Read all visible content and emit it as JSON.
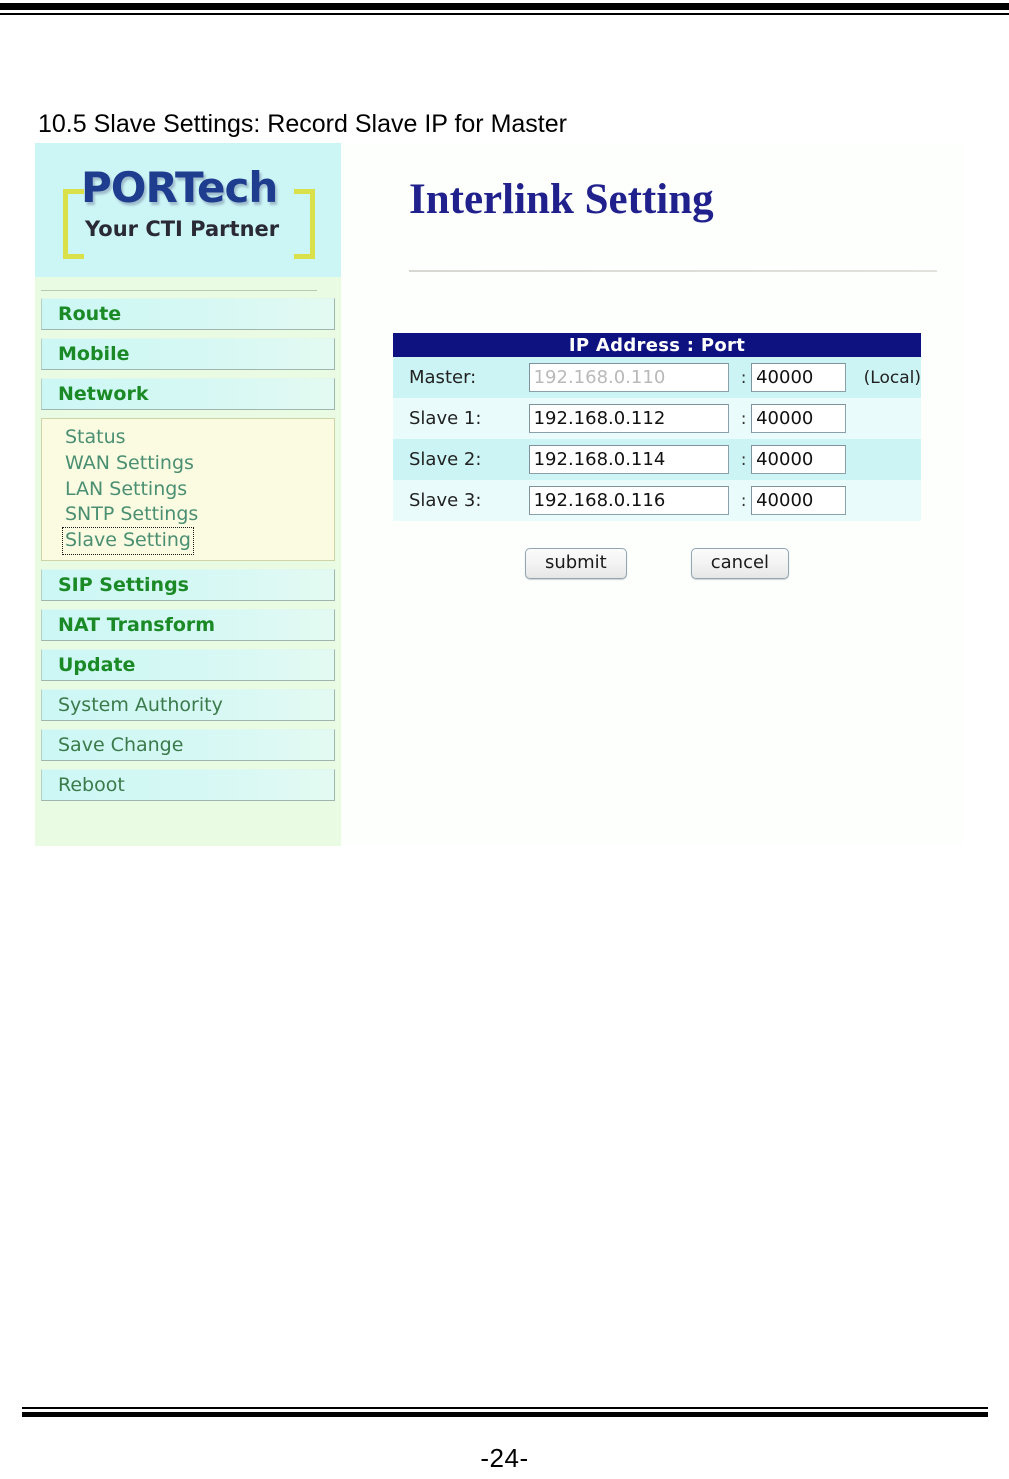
{
  "document": {
    "section_heading": "10.5 Slave Settings: Record Slave IP for Master",
    "page_number": "-24-"
  },
  "sidebar": {
    "logo": {
      "main": "PORTech",
      "tagline": "Your CTI Partner"
    },
    "menu": [
      {
        "label": "Route",
        "style": "bold"
      },
      {
        "label": "Mobile",
        "style": "bold"
      },
      {
        "label": "Network",
        "style": "bold"
      }
    ],
    "submenu": [
      {
        "label": "Status",
        "active": false
      },
      {
        "label": "WAN Settings",
        "active": false
      },
      {
        "label": "LAN Settings",
        "active": false
      },
      {
        "label": "SNTP Settings",
        "active": false
      },
      {
        "label": "Slave Setting",
        "active": true
      }
    ],
    "menu_lower": [
      {
        "label": "SIP Settings",
        "style": "bold"
      },
      {
        "label": "NAT Transform",
        "style": "bold"
      },
      {
        "label": "Update",
        "style": "bold"
      },
      {
        "label": "System Authority",
        "style": "plain"
      },
      {
        "label": "Save Change",
        "style": "plain"
      },
      {
        "label": "Reboot",
        "style": "plain"
      }
    ]
  },
  "content": {
    "title": "Interlink Setting",
    "table": {
      "header": "IP Address : Port",
      "separator": ":",
      "rows": [
        {
          "label": "Master:",
          "ip": "192.168.0.110",
          "port": "40000",
          "note": "(Local)",
          "disabled": true
        },
        {
          "label": "Slave 1:",
          "ip": "192.168.0.112",
          "port": "40000",
          "note": "",
          "disabled": false
        },
        {
          "label": "Slave 2:",
          "ip": "192.168.0.114",
          "port": "40000",
          "note": "",
          "disabled": false
        },
        {
          "label": "Slave 3:",
          "ip": "192.168.0.116",
          "port": "40000",
          "note": "",
          "disabled": false
        }
      ]
    },
    "buttons": {
      "submit": "submit",
      "cancel": "cancel"
    }
  },
  "colors": {
    "table_header_bg": "#0e1280",
    "title_blue": "#20218c",
    "menu_green": "#1b8a26",
    "logo_blue": "#1f3d8f",
    "bracket_yellow": "#d9e04a",
    "sidebar_bg": "#e9fbe2",
    "menu_item_bg": "#ccf7f5",
    "submenu_bg": "#fbfbe2",
    "row_a_bg": "#ccf4f4",
    "row_b_bg": "#e9fcfb"
  }
}
